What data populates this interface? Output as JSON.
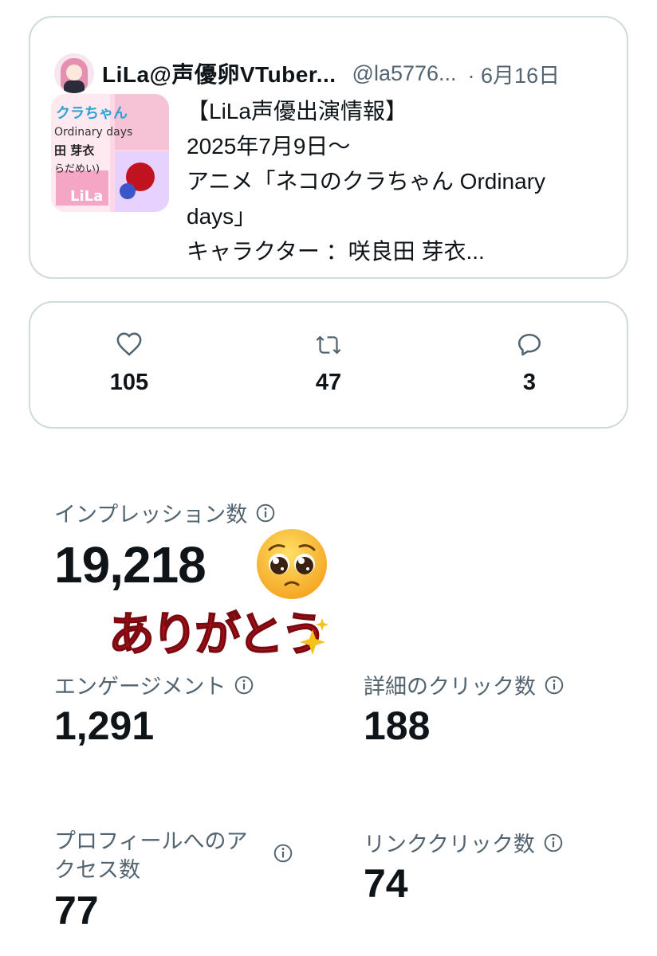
{
  "tweet": {
    "author": "LiLa@声優卵VTuber...",
    "handle": "@la5776...",
    "date": "· 6月16日",
    "text_lines": [
      "【LiLa声優出演情報】",
      "2025年7月9日〜",
      "アニメ「ネコのクラちゃん Ordinary",
      "days」",
      "キャラクター ：咲良田 芽衣..."
    ],
    "thumbnail": {
      "banner": "クラちゃん",
      "subtitle": "Ordinary days",
      "name": "田 芽衣",
      "reading": "らだめい)",
      "signature": "LiLa"
    }
  },
  "engagement": {
    "likes": "105",
    "retweets": "47",
    "replies": "3",
    "like_icon": "heart-icon",
    "retweet_icon": "retweet-icon",
    "reply_icon": "speech-bubble-icon"
  },
  "metrics": {
    "impressions_label": "インプレッション数",
    "impressions_value": "19,218",
    "engagement_label": "エンゲージメント",
    "engagement_value": "1,291",
    "detail_clicks_label": "詳細のクリック数",
    "detail_clicks_value": "188",
    "profile_access_label_1": "プロフィールへのア",
    "profile_access_label_2": "クセス数",
    "profile_access_value": "77",
    "link_clicks_label": "リンククリック数",
    "link_clicks_value": "74"
  },
  "sticker": {
    "emoji": "pleading-face-emoji",
    "text": "ありがとう",
    "sparkle": "sparkle-icon"
  },
  "colors": {
    "text": "#0f1419",
    "secondary": "#536471",
    "border": "#cfd9de",
    "sticker_red": "#b5121b"
  }
}
